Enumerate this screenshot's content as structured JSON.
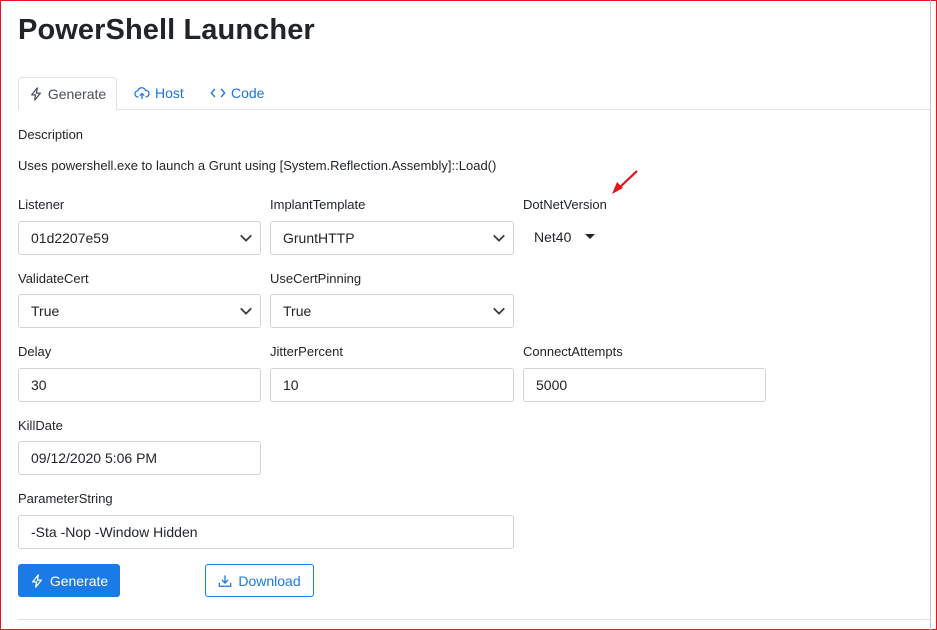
{
  "page": {
    "title": "PowerShell Launcher"
  },
  "tabs": [
    {
      "label": "Generate",
      "icon": "lightning-icon",
      "active": true
    },
    {
      "label": "Host",
      "icon": "cloud-upload-icon",
      "active": false
    },
    {
      "label": "Code",
      "icon": "code-icon",
      "active": false
    }
  ],
  "description": {
    "label": "Description",
    "text": "Uses powershell.exe to launch a Grunt using [System.Reflection.Assembly]::Load()"
  },
  "fields": {
    "listener": {
      "label": "Listener",
      "value": "01d2207e59"
    },
    "implant_template": {
      "label": "ImplantTemplate",
      "value": "GruntHTTP"
    },
    "dotnet_version": {
      "label": "DotNetVersion",
      "value": "Net40"
    },
    "validate_cert": {
      "label": "ValidateCert",
      "value": "True"
    },
    "use_cert_pinning": {
      "label": "UseCertPinning",
      "value": "True"
    },
    "delay": {
      "label": "Delay",
      "value": "30"
    },
    "jitter_percent": {
      "label": "JitterPercent",
      "value": "10"
    },
    "connect_attempts": {
      "label": "ConnectAttempts",
      "value": "5000"
    },
    "kill_date": {
      "label": "KillDate",
      "value": "09/12/2020 5:06 PM"
    },
    "parameter_string": {
      "label": "ParameterString",
      "value": "-Sta -Nop -Window Hidden"
    }
  },
  "buttons": {
    "generate": "Generate",
    "download": "Download"
  },
  "colors": {
    "primary": "#1a7ae6",
    "annotation": "#e8141b",
    "border": "#ced4da"
  }
}
